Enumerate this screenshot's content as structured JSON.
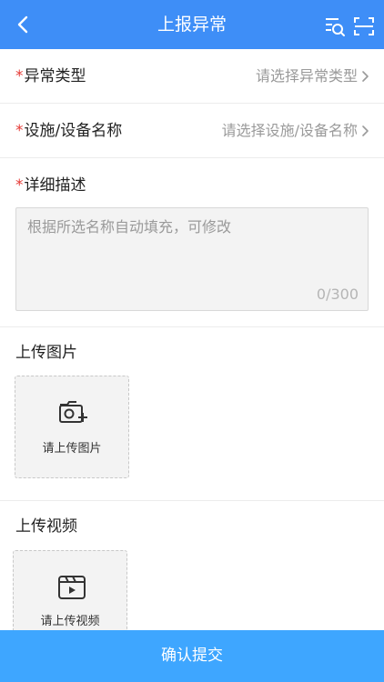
{
  "header": {
    "title": "上报异常",
    "bg_color": "#3e8ef7"
  },
  "form": {
    "required_mark": "*",
    "type_field": {
      "label": "异常类型",
      "placeholder": "请选择异常类型"
    },
    "facility_field": {
      "label": "设施/设备名称",
      "placeholder": "请选择设施/设备名称"
    },
    "description": {
      "label": "详细描述",
      "placeholder": "根据所选名称自动填充，可修改",
      "counter": "0/300"
    },
    "image_upload": {
      "label": "上传图片",
      "button_text": "请上传图片"
    },
    "video_upload": {
      "label": "上传视频",
      "button_text": "请上传视频"
    }
  },
  "footer": {
    "submit_label": "确认提交",
    "submit_color": "#3ea6ff"
  }
}
